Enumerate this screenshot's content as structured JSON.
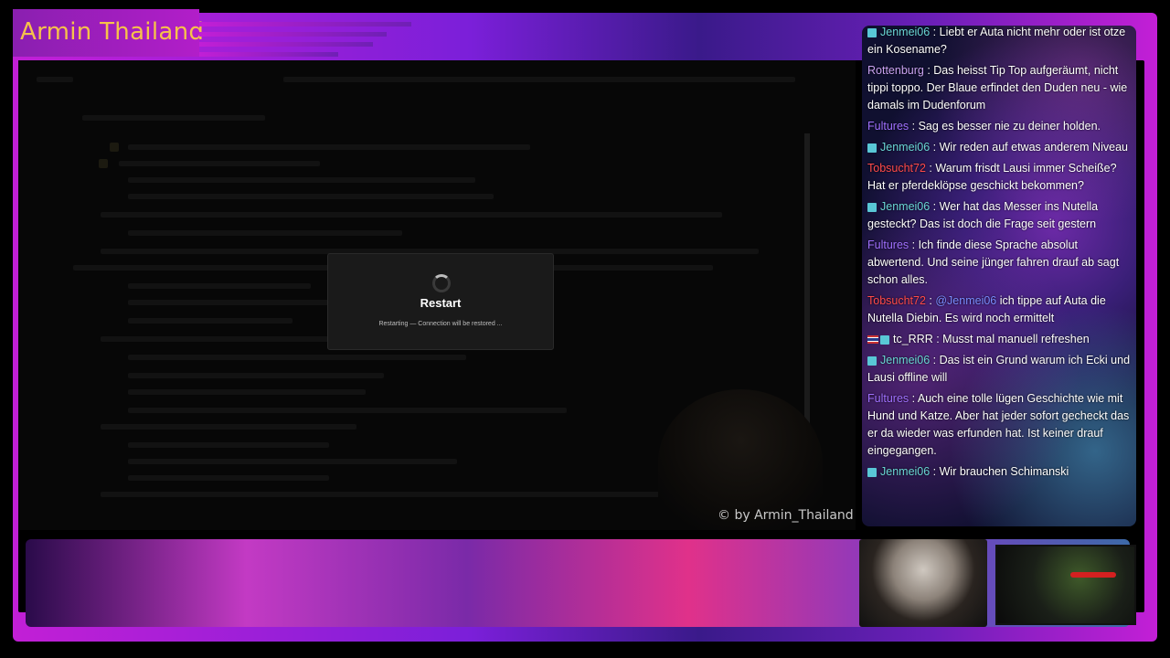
{
  "brand": {
    "title": "Armin Thailand",
    "accent_color": "#c21fd6",
    "title_color": "#f6c24a"
  },
  "overlay": {
    "copyright": "© by Armin_Thailand"
  },
  "dialog": {
    "title": "Restart",
    "message": "Restarting — Connection will be restored ...",
    "icon": "spinner-icon"
  },
  "chat": {
    "messages": [
      {
        "user": "Jenmei06",
        "color": "#6ad6d6",
        "badge": true,
        "flag": false,
        "text": " : Liebt er Auta nicht mehr oder ist otze ein Kosename?"
      },
      {
        "user": "Rottenburg",
        "color": "#c9a2f0",
        "badge": false,
        "flag": false,
        "text": " : Das heisst Tip Top aufgeräumt, nicht tippi toppo. Der Blaue erfindet den Duden neu - wie damals im Dudenforum"
      },
      {
        "user": "Fultures",
        "color": "#a070ff",
        "badge": false,
        "flag": false,
        "text": " : Sag es besser nie zu deiner holden."
      },
      {
        "user": "Jenmei06",
        "color": "#6ad6d6",
        "badge": true,
        "flag": false,
        "text": " : Wir reden auf etwas anderem Niveau"
      },
      {
        "user": "Tobsucht72",
        "color": "#ff4a4a",
        "badge": false,
        "flag": false,
        "text": " : Warum frisdt Lausi immer Scheiße? Hat er pferdeklöpse geschickt bekommen?"
      },
      {
        "user": "Jenmei06",
        "color": "#6ad6d6",
        "badge": true,
        "flag": false,
        "text": " : Wer hat das Messer ins Nutella gesteckt? Das ist doch die Frage seit gestern"
      },
      {
        "user": "Fultures",
        "color": "#a070ff",
        "badge": false,
        "flag": false,
        "text": " : Ich finde diese Sprache absolut abwertend. Und seine jünger fahren drauf ab sagt schon alles."
      },
      {
        "user": "Tobsucht72",
        "color": "#ff4a4a",
        "badge": false,
        "flag": false,
        "mention": "@Jenmei06",
        "text": " ich tippe auf Auta die Nutella Diebin. Es wird noch ermittelt"
      },
      {
        "user": "tc_RRR",
        "color": "#ffffff",
        "badge": true,
        "flag": true,
        "text": " : Musst mal manuell refreshen"
      },
      {
        "user": "Jenmei06",
        "color": "#6ad6d6",
        "badge": true,
        "flag": false,
        "text": " : Das ist ein Grund warum ich Ecki und Lausi offline will"
      },
      {
        "user": "Fultures",
        "color": "#a070ff",
        "badge": false,
        "flag": false,
        "text": " : Auch eine tolle lügen Geschichte wie mit Hund und Katze. Aber hat jeder sofort gecheckt das er da wieder was erfunden hat. Ist keiner drauf eingegangen."
      },
      {
        "user": "Jenmei06",
        "color": "#6ad6d6",
        "badge": true,
        "flag": false,
        "text": " : Wir brauchen Schimanski"
      }
    ]
  }
}
